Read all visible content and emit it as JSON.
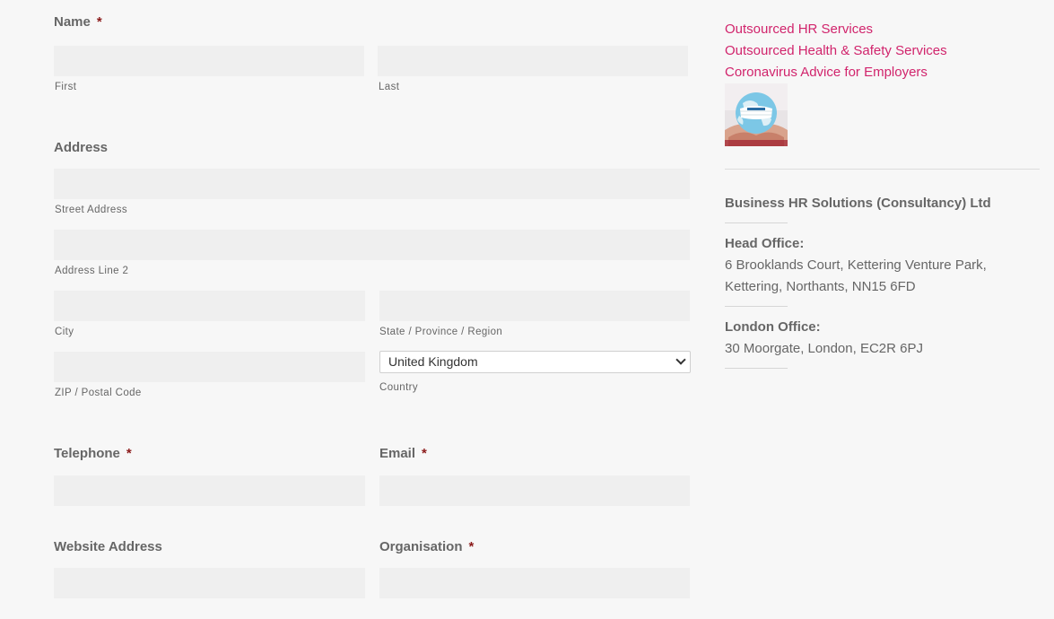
{
  "form": {
    "name": {
      "label": "Name",
      "required_mark": "*",
      "first_sublabel": "First",
      "last_sublabel": "Last",
      "first_value": "",
      "last_value": ""
    },
    "address": {
      "label": "Address",
      "street_sublabel": "Street Address",
      "line2_sublabel": "Address Line 2",
      "city_sublabel": "City",
      "state_sublabel": "State / Province / Region",
      "zip_sublabel": "ZIP / Postal Code",
      "country_sublabel": "Country",
      "country_selected": "United Kingdom",
      "street_value": "",
      "line2_value": "",
      "city_value": "",
      "state_value": "",
      "zip_value": ""
    },
    "telephone": {
      "label": "Telephone",
      "required_mark": "*",
      "value": ""
    },
    "email": {
      "label": "Email",
      "required_mark": "*",
      "value": ""
    },
    "website": {
      "label": "Website Address",
      "value": ""
    },
    "organisation": {
      "label": "Organisation",
      "required_mark": "*",
      "value": ""
    }
  },
  "sidebar": {
    "links": [
      "Outsourced HR Services",
      "Outsourced Health & Safety Services",
      "Coronavirus Advice for Employers"
    ],
    "company_name": "Business HR Solutions (Consultancy) Ltd",
    "head_office": {
      "label": "Head Office:",
      "line1": "6 Brooklands Court, Kettering Venture Park,",
      "line2": "Kettering, Northants, NN15 6FD"
    },
    "london_office": {
      "label": "London Office:",
      "line1": "30 Moorgate, London, EC2R 6PJ"
    }
  },
  "colors": {
    "link": "#d1246c",
    "required": "#8b1a1a",
    "text": "#666666",
    "input_bg": "#efefef",
    "page_bg": "#f7f7f7"
  }
}
